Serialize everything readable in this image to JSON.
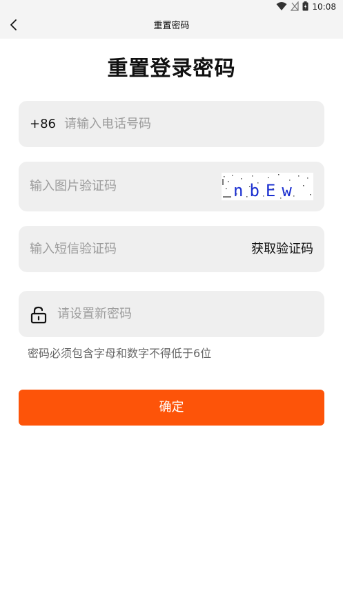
{
  "status_bar": {
    "time": "10:08",
    "icons": [
      "wifi-icon",
      "signal-icon",
      "battery-icon"
    ]
  },
  "nav": {
    "title": "重置密码",
    "back_icon": "chevron-left-icon"
  },
  "heading": "重置登录密码",
  "phone": {
    "country_code": "+86",
    "placeholder": "请输入电话号码",
    "value": ""
  },
  "captcha": {
    "placeholder": "输入图片验证码",
    "value": "",
    "image_text": "nbEw"
  },
  "sms": {
    "placeholder": "输入短信验证码",
    "value": "",
    "get_code_label": "获取验证码"
  },
  "password": {
    "placeholder": "请设置新密码",
    "value": "",
    "icon": "unlock-icon"
  },
  "hint": "密码必须包含字母和数字不得低于6位",
  "confirm_label": "确定",
  "colors": {
    "accent": "#fd5409",
    "field_bg": "#efefef",
    "placeholder": "#9c9c9c",
    "header_bg": "#f4f4f4",
    "captcha_text": "#1a2fd0"
  }
}
